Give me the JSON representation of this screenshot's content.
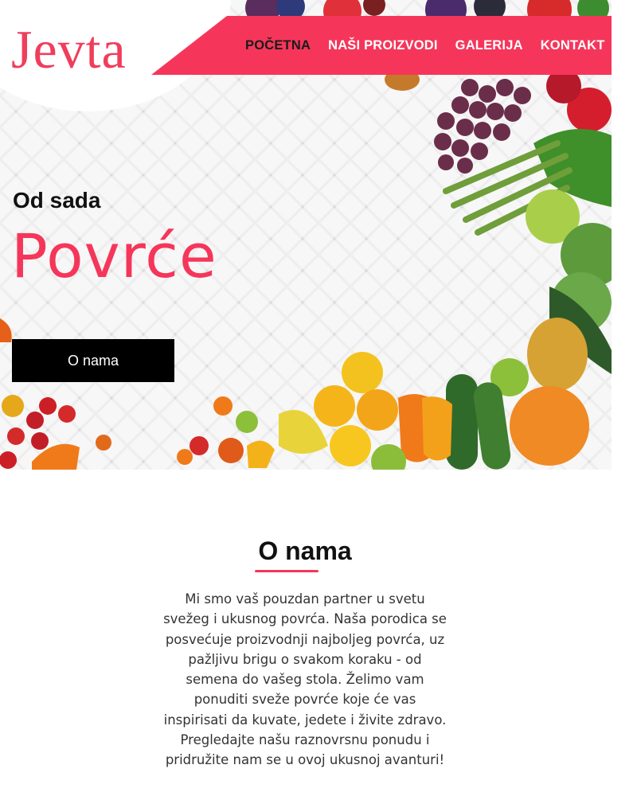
{
  "brand": {
    "logo_text": "Jevta",
    "accent_color": "#f5365a"
  },
  "nav": {
    "items": [
      {
        "label": "POČETNA",
        "active": true
      },
      {
        "label": "NAŠI PROIZVODI",
        "active": false
      },
      {
        "label": "GALERIJA",
        "active": false
      },
      {
        "label": "KONTAKT",
        "active": false
      }
    ]
  },
  "hero": {
    "eyebrow": "Od sada",
    "headline": "Povrće",
    "cta_label": "O nama",
    "background_image": "fresh-fruits-and-vegetables-photo"
  },
  "about": {
    "title": "O nama",
    "body": "Mi smo vaš pouzdan partner u svetu svežeg i ukusnog povrća. Naša porodica se posvećuje proizvodnji najboljeg povrća, uz pažljivu brigu o svakom koraku - od semena do vašeg stola. Želimo vam ponuditi sveže povrće koje će vas inspirisati da kuvate, jedete i živite zdravo. Pregledajte našu raznovrsnu ponudu i pridružite nam se u ovoj ukusnoj avanturi!"
  }
}
